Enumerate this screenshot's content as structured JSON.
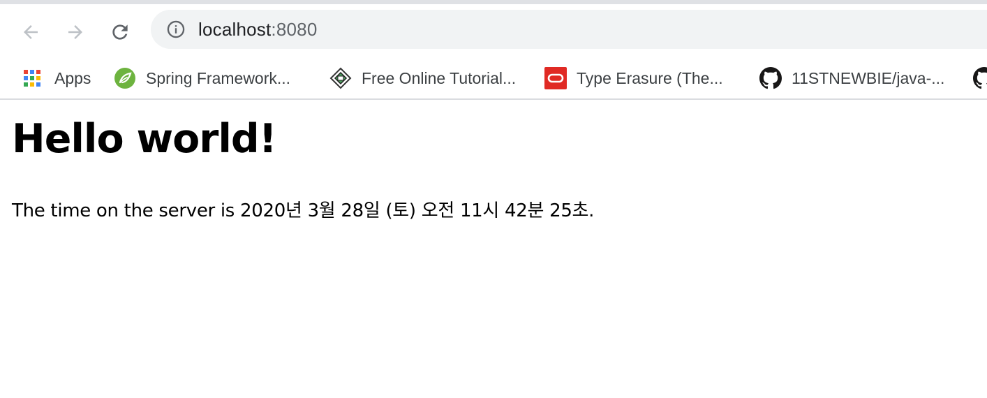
{
  "browser": {
    "address": {
      "host": "localhost",
      "port": ":8080"
    },
    "bookmarks": [
      {
        "label": "Apps",
        "icon": "apps-grid-icon"
      },
      {
        "label": "Spring Framework...",
        "icon": "spring-leaf-icon"
      },
      {
        "label": "Free Online Tutorial...",
        "icon": "tutorial-logo-icon"
      },
      {
        "label": "Type Erasure (The...",
        "icon": "oracle-icon"
      },
      {
        "label": "11STNEWBIE/java-...",
        "icon": "github-icon"
      }
    ]
  },
  "page": {
    "heading": "Hello world!",
    "paragraph": "The time on the server is 2020년 3월 28일 (토) 오전 11시 42분 25초."
  },
  "colors": {
    "spring": "#6db33f",
    "oracle": "#e02a24",
    "github": "#181717",
    "omnibox": "#f1f3f4"
  }
}
